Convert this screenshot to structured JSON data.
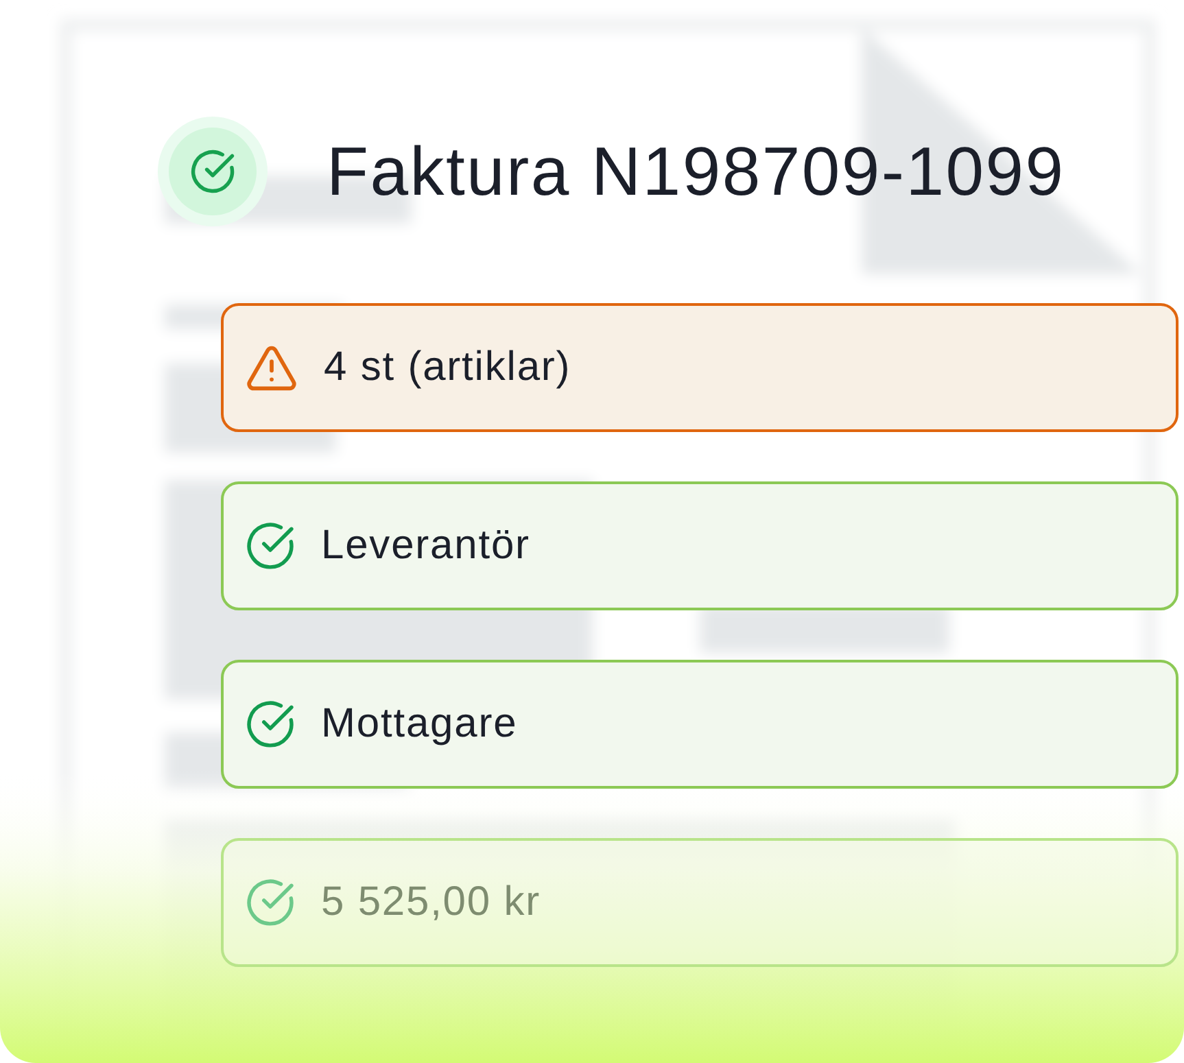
{
  "title": {
    "text": "Faktura N198709-1099",
    "verified": true
  },
  "checks": [
    {
      "kind": "warning",
      "label": "4 st (artiklar)",
      "dimmed": false
    },
    {
      "kind": "ok",
      "label": "Leverantör",
      "dimmed": false
    },
    {
      "kind": "ok",
      "label": "Mottagare",
      "dimmed": false
    },
    {
      "kind": "ok",
      "label": "5 525,00 kr",
      "dimmed": true
    }
  ]
}
